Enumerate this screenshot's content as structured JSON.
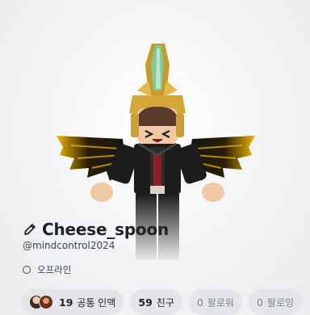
{
  "profile": {
    "display_name": "Cheese_spoon",
    "username": "@mindcontrol2024",
    "status": "오프라인"
  },
  "stats": {
    "mutual": {
      "count": "19",
      "label": "공통 인맥"
    },
    "friends": {
      "count": "59",
      "label": "친구"
    },
    "followers": {
      "count": "0",
      "label": "팔로워"
    },
    "following": {
      "count": "0",
      "label": "팔로잉"
    }
  },
  "icons": {
    "edit": "pencil-icon",
    "status": "offline-circle-icon"
  },
  "colors": {
    "text_primary": "#1f2328",
    "text_secondary": "#3d4450",
    "chip_bg": "#e3e5e8",
    "wing_yellow": "#f2b705",
    "wing_black": "#141414"
  }
}
